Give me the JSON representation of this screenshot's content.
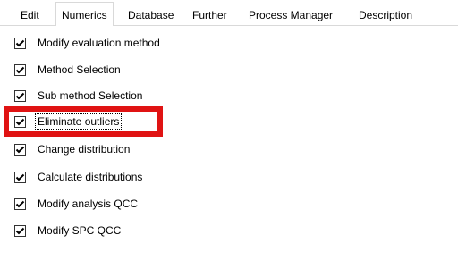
{
  "tabs": [
    {
      "label": "Edit",
      "active": false
    },
    {
      "label": "Numerics",
      "active": true
    },
    {
      "label": "Database",
      "active": false
    },
    {
      "label": "Further",
      "active": false
    },
    {
      "label": "Process Manager",
      "active": false
    },
    {
      "label": "Description",
      "active": false
    }
  ],
  "checkboxes": [
    {
      "label": "Modify evaluation method",
      "checked": true
    },
    {
      "label": "Method Selection",
      "checked": true
    },
    {
      "label": "Sub method Selection",
      "checked": true
    },
    {
      "label": "Eliminate outliers",
      "checked": true,
      "focused": true,
      "highlighted": true
    },
    {
      "label": "Change distribution",
      "checked": true
    },
    {
      "label": "Calculate distributions",
      "checked": true
    },
    {
      "label": "Modify analysis QCC",
      "checked": true
    },
    {
      "label": "Modify SPC QCC",
      "checked": true
    }
  ],
  "colors": {
    "highlight": "#e01313",
    "check": "#000000",
    "tab_border": "#d9d9d9"
  }
}
